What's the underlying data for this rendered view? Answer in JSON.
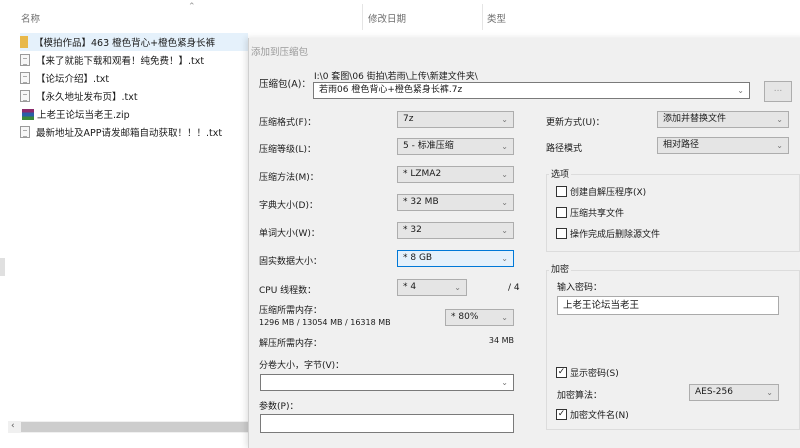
{
  "explorer": {
    "columns": {
      "name": "名称",
      "modified": "修改日期",
      "type": "类型"
    },
    "files": [
      {
        "name": "【模拍作品】463 橙色背心+橙色紧身长裤",
        "icon": "folder-icon",
        "selected": true
      },
      {
        "name": "【来了就能下载和观看！纯免费！】.txt",
        "icon": "text-file-icon"
      },
      {
        "name": "【论坛介绍】.txt",
        "icon": "text-file-icon"
      },
      {
        "name": "【永久地址发布页】.txt",
        "icon": "text-file-icon"
      },
      {
        "name": "上老王论坛当老王.zip",
        "icon": "winrar-archive-icon"
      },
      {
        "name": "最新地址及APP请发邮箱自动获取！！！.txt",
        "icon": "text-file-icon"
      }
    ]
  },
  "dialog": {
    "title": "添加到压缩包",
    "archive_label": "压缩包(A)：",
    "archive_path": "I:\\0 套图\\06 街拍\\若雨\\上传\\新建文件夹\\",
    "archive_name": "若雨06 橙色背心+橙色紧身长裤.7z",
    "browse": "...",
    "format": {
      "label": "压缩格式(F)：",
      "value": "7z"
    },
    "level": {
      "label": "压缩等级(L)：",
      "value": "5 - 标准压缩"
    },
    "method": {
      "label": "压缩方法(M)：",
      "value": "* LZMA2"
    },
    "dict": {
      "label": "字典大小(D)：",
      "value": "* 32 MB"
    },
    "word": {
      "label": "单词大小(W)：",
      "value": "* 32"
    },
    "solid": {
      "label": "固实数据大小：",
      "value": "* 8 GB"
    },
    "cpu": {
      "label": "CPU 线程数：",
      "value": "* 4",
      "max": "/ 4"
    },
    "mem_comp": {
      "label": "压缩所需内存：",
      "detail": "1296 MB / 13054 MB / 16318 MB",
      "value": "* 80%"
    },
    "mem_decomp": {
      "label": "解压所需内存：",
      "value": "34 MB"
    },
    "split": {
      "label": "分卷大小，字节(V)：",
      "value": ""
    },
    "params": {
      "label": "参数(P)：",
      "value": ""
    },
    "update": {
      "label": "更新方式(U)：",
      "value": "添加并替换文件"
    },
    "pathmode": {
      "label": "路径模式",
      "value": "相对路径"
    },
    "options": {
      "title": "选项",
      "items": [
        {
          "label": "创建自解压程序(X)",
          "checked": false
        },
        {
          "label": "压缩共享文件",
          "checked": false
        },
        {
          "label": "操作完成后删除源文件",
          "checked": false
        }
      ]
    },
    "encryption": {
      "title": "加密",
      "pw_label": "输入密码：",
      "password": "上老王论坛当老王",
      "show_pw": {
        "label": "显示密码(S)",
        "checked": true
      },
      "algo_label": "加密算法：",
      "algo": "AES-256",
      "enc_names": {
        "label": "加密文件名(N)",
        "checked": true
      }
    }
  }
}
